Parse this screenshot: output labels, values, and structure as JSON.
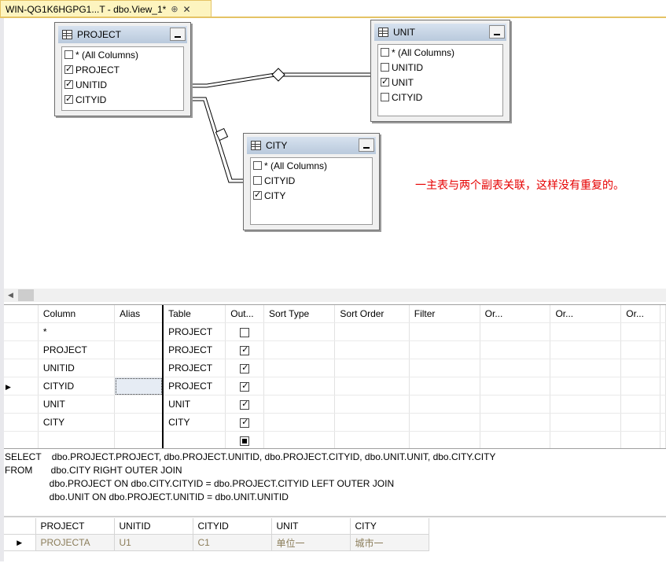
{
  "tab": {
    "title": "WIN-QG1K6HGPG1...T - dbo.View_1*",
    "pin_glyph": "⊕",
    "close_glyph": "✕"
  },
  "diagram": {
    "tables": [
      {
        "name": "PROJECT",
        "columns": [
          {
            "label": "* (All Columns)",
            "checked": false
          },
          {
            "label": "PROJECT",
            "checked": true
          },
          {
            "label": "UNITID",
            "checked": true
          },
          {
            "label": "CITYID",
            "checked": true
          }
        ]
      },
      {
        "name": "UNIT",
        "columns": [
          {
            "label": "* (All Columns)",
            "checked": false
          },
          {
            "label": "UNITID",
            "checked": false
          },
          {
            "label": "UNIT",
            "checked": true
          },
          {
            "label": "CITYID",
            "checked": false
          }
        ]
      },
      {
        "name": "CITY",
        "columns": [
          {
            "label": "* (All Columns)",
            "checked": false
          },
          {
            "label": "CITYID",
            "checked": false
          },
          {
            "label": "CITY",
            "checked": true
          }
        ]
      }
    ],
    "note": "一主表与两个副表关联，这样没有重复的。"
  },
  "grid": {
    "headers": [
      "Column",
      "Alias",
      "Table",
      "Out...",
      "Sort Type",
      "Sort Order",
      "Filter",
      "Or...",
      "Or...",
      "Or..."
    ],
    "rows": [
      {
        "column": "*",
        "alias": "",
        "table": "PROJECT",
        "output": "unchecked"
      },
      {
        "column": "PROJECT",
        "alias": "",
        "table": "PROJECT",
        "output": "checked"
      },
      {
        "column": "UNITID",
        "alias": "",
        "table": "PROJECT",
        "output": "checked"
      },
      {
        "column": "CITYID",
        "alias": "",
        "table": "PROJECT",
        "output": "checked"
      },
      {
        "column": "UNIT",
        "alias": "",
        "table": "UNIT",
        "output": "checked"
      },
      {
        "column": "CITY",
        "alias": "",
        "table": "CITY",
        "output": "checked"
      },
      {
        "column": "",
        "alias": "",
        "table": "",
        "output": "indeterminate"
      }
    ],
    "current_row_index": 3
  },
  "sql": {
    "lines": [
      "SELECT    dbo.PROJECT.PROJECT, dbo.PROJECT.UNITID, dbo.PROJECT.CITYID, dbo.UNIT.UNIT, dbo.CITY.CITY",
      "FROM       dbo.CITY RIGHT OUTER JOIN",
      "                 dbo.PROJECT ON dbo.CITY.CITYID = dbo.PROJECT.CITYID LEFT OUTER JOIN",
      "                 dbo.UNIT ON dbo.PROJECT.UNITID = dbo.UNIT.UNITID"
    ]
  },
  "results": {
    "headers": [
      "PROJECT",
      "UNITID",
      "CITYID",
      "UNIT",
      "CITY"
    ],
    "rows": [
      [
        "PROJECTA",
        "U1",
        "C1",
        "单位一",
        "城市一"
      ]
    ]
  },
  "colors": {
    "note": "#e60000",
    "tab_bg": "#fdf4bf",
    "header_gradient": "#b9c9dc"
  }
}
